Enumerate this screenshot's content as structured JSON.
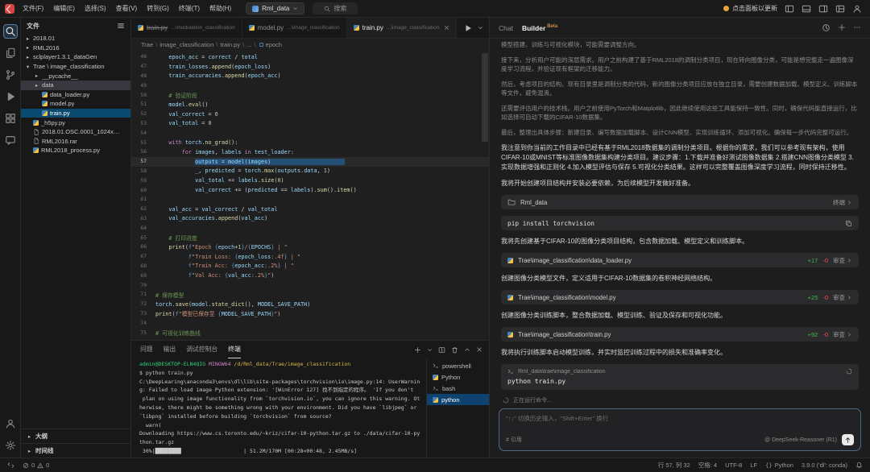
{
  "colors": {
    "selection": "#264f78",
    "list_active": "#0a4a6e",
    "added": "#3fb950",
    "removed": "#f85149",
    "beta": "#c98f4e",
    "update_dot": "#e8a33d"
  },
  "titlebar": {
    "menus": [
      "文件(F)",
      "编辑(E)",
      "选择(S)",
      "查看(V)",
      "转到(G)",
      "终端(T)",
      "帮助(H)"
    ],
    "project": "Rml_data",
    "search": "搜索",
    "update": "点击面板以更新"
  },
  "activity": {
    "top": [
      "search",
      "files",
      "scm",
      "debug",
      "extensions",
      "chat"
    ],
    "bottom": [
      "account",
      "settings"
    ]
  },
  "sidebar": {
    "title": "文件",
    "tree": [
      {
        "label": "2018.01",
        "depth": 0,
        "kind": "folder"
      },
      {
        "label": "RML2016",
        "depth": 0,
        "kind": "folder"
      },
      {
        "label": "sclplayer1.3.1_dataGen",
        "depth": 0,
        "kind": "folder"
      },
      {
        "label": "Trae \\ image_classification",
        "depth": 0,
        "kind": "folder",
        "expanded": true
      },
      {
        "label": "__pycache__",
        "depth": 1,
        "kind": "folder"
      },
      {
        "label": "data",
        "depth": 1,
        "kind": "folder",
        "boxed": true
      },
      {
        "label": "data_loader.py",
        "depth": 1,
        "kind": "py"
      },
      {
        "label": "model.py",
        "depth": 1,
        "kind": "py"
      },
      {
        "label": "train.py",
        "depth": 1,
        "kind": "py",
        "selected": true
      },
      {
        "label": "_h5py.py",
        "depth": 0,
        "kind": "py"
      },
      {
        "label": "2018.01.OSC.0001_1024x…",
        "depth": 0,
        "kind": "file"
      },
      {
        "label": "RML2016.rar",
        "depth": 0,
        "kind": "file"
      },
      {
        "label": "RML2018_process.py",
        "depth": 0,
        "kind": "py"
      }
    ],
    "outline": "大纲",
    "timeline": "时间线"
  },
  "editor": {
    "tabs": [
      {
        "name": "train.py",
        "path": "...\\modulation_classification",
        "deleted": true
      },
      {
        "name": "model.py",
        "path": "...\\image_classification"
      },
      {
        "name": "train.py",
        "path": "...\\image_classification",
        "active": true
      }
    ],
    "breadcrumb": [
      "Trae",
      "image_classification",
      "train.py",
      "...",
      "epoch"
    ],
    "code": {
      "start": 46,
      "current": 57,
      "lines": [
        {
          "i": 4,
          "t": [
            [
              "v",
              "epoch_acc"
            ],
            [
              "o",
              " = "
            ],
            [
              "v",
              "correct"
            ],
            [
              "o",
              " / "
            ],
            [
              "v",
              "total"
            ]
          ]
        },
        {
          "i": 4,
          "t": [
            [
              "v",
              "train_losses"
            ],
            [
              "o",
              "."
            ],
            [
              "f",
              "append"
            ],
            [
              "o",
              "("
            ],
            [
              "v",
              "epoch_loss"
            ],
            [
              "o",
              ")"
            ]
          ]
        },
        {
          "i": 4,
          "t": [
            [
              "v",
              "train_accuracies"
            ],
            [
              "o",
              "."
            ],
            [
              "f",
              "append"
            ],
            [
              "o",
              "("
            ],
            [
              "v",
              "epoch_acc"
            ],
            [
              "o",
              ")"
            ]
          ]
        },
        {
          "i": 0,
          "t": []
        },
        {
          "i": 4,
          "t": [
            [
              "c",
              "# 验证阶段"
            ]
          ]
        },
        {
          "i": 4,
          "t": [
            [
              "v",
              "model"
            ],
            [
              "o",
              "."
            ],
            [
              "f",
              "eval"
            ],
            [
              "o",
              "()"
            ]
          ]
        },
        {
          "i": 4,
          "t": [
            [
              "v",
              "val_correct"
            ],
            [
              "o",
              " = "
            ],
            [
              "n",
              "0"
            ]
          ]
        },
        {
          "i": 4,
          "t": [
            [
              "v",
              "val_total"
            ],
            [
              "o",
              " = "
            ],
            [
              "n",
              "0"
            ]
          ]
        },
        {
          "i": 0,
          "t": []
        },
        {
          "i": 4,
          "t": [
            [
              "k",
              "with"
            ],
            [
              "o",
              " "
            ],
            [
              "v",
              "torch"
            ],
            [
              "o",
              "."
            ],
            [
              "f",
              "no_grad"
            ],
            [
              "o",
              "():"
            ]
          ]
        },
        {
          "i": 8,
          "t": [
            [
              "k",
              "for"
            ],
            [
              "o",
              " "
            ],
            [
              "v",
              "images"
            ],
            [
              "o",
              ", "
            ],
            [
              "v",
              "labels"
            ],
            [
              "o",
              " "
            ],
            [
              "k",
              "in"
            ],
            [
              "o",
              " "
            ],
            [
              "v",
              "test_loader"
            ],
            [
              "o",
              ":"
            ]
          ]
        },
        {
          "i": 12,
          "t": [
            [
              "v",
              "outputs"
            ],
            [
              "o",
              " = "
            ],
            [
              "v",
              "model"
            ],
            [
              "o",
              "("
            ],
            [
              "v",
              "images"
            ],
            [
              "o",
              ")"
            ]
          ]
        },
        {
          "i": 12,
          "t": [
            [
              "v",
              "_"
            ],
            [
              "o",
              ", "
            ],
            [
              "v",
              "predicted"
            ],
            [
              "o",
              " = "
            ],
            [
              "v",
              "torch"
            ],
            [
              "o",
              "."
            ],
            [
              "f",
              "max"
            ],
            [
              "o",
              "("
            ],
            [
              "v",
              "outputs"
            ],
            [
              "o",
              "."
            ],
            [
              "v",
              "data"
            ],
            [
              "o",
              ", "
            ],
            [
              "n",
              "1"
            ],
            [
              "o",
              ")"
            ]
          ]
        },
        {
          "i": 12,
          "t": [
            [
              "v",
              "val_total"
            ],
            [
              "o",
              " += "
            ],
            [
              "v",
              "labels"
            ],
            [
              "o",
              "."
            ],
            [
              "f",
              "size"
            ],
            [
              "o",
              "("
            ],
            [
              "n",
              "0"
            ],
            [
              "o",
              ")"
            ]
          ]
        },
        {
          "i": 12,
          "t": [
            [
              "v",
              "val_correct"
            ],
            [
              "o",
              " += ("
            ],
            [
              "v",
              "predicted"
            ],
            [
              "o",
              " == "
            ],
            [
              "v",
              "labels"
            ],
            [
              "o",
              ")."
            ],
            [
              "f",
              "sum"
            ],
            [
              "o",
              "()."
            ],
            [
              "f",
              "item"
            ],
            [
              "o",
              "()"
            ]
          ]
        },
        {
          "i": 0,
          "t": []
        },
        {
          "i": 4,
          "t": [
            [
              "v",
              "val_acc"
            ],
            [
              "o",
              " = "
            ],
            [
              "v",
              "val_correct"
            ],
            [
              "o",
              " / "
            ],
            [
              "v",
              "val_total"
            ]
          ]
        },
        {
          "i": 4,
          "t": [
            [
              "v",
              "val_accuracies"
            ],
            [
              "o",
              "."
            ],
            [
              "f",
              "append"
            ],
            [
              "o",
              "("
            ],
            [
              "v",
              "val_acc"
            ],
            [
              "o",
              ")"
            ]
          ]
        },
        {
          "i": 0,
          "t": []
        },
        {
          "i": 4,
          "t": [
            [
              "c",
              "# 打印进度"
            ]
          ]
        },
        {
          "i": 4,
          "t": [
            [
              "f",
              "print"
            ],
            [
              "o",
              "("
            ],
            [
              "b",
              "f"
            ],
            [
              "s",
              "\"Epoch "
            ],
            [
              "b",
              "{"
            ],
            [
              "v",
              "epoch"
            ],
            [
              "o",
              "+"
            ],
            [
              "n",
              "1"
            ],
            [
              "b",
              "}"
            ],
            [
              "s",
              "/"
            ],
            [
              "b",
              "{"
            ],
            [
              "v",
              "EPOCHS"
            ],
            [
              "b",
              "}"
            ],
            [
              "s",
              " | \""
            ]
          ]
        },
        {
          "i": 10,
          "t": [
            [
              "b",
              "f"
            ],
            [
              "s",
              "\"Train Loss: "
            ],
            [
              "b",
              "{"
            ],
            [
              "v",
              "epoch_loss"
            ],
            [
              "s",
              ":.4f"
            ],
            [
              "b",
              "}"
            ],
            [
              "s",
              " | \""
            ]
          ]
        },
        {
          "i": 10,
          "t": [
            [
              "b",
              "f"
            ],
            [
              "s",
              "\"Train Acc: "
            ],
            [
              "b",
              "{"
            ],
            [
              "v",
              "epoch_acc"
            ],
            [
              "s",
              ":.2%"
            ],
            [
              "b",
              "}"
            ],
            [
              "s",
              " | \""
            ]
          ]
        },
        {
          "i": 10,
          "t": [
            [
              "b",
              "f"
            ],
            [
              "s",
              "\"Val Acc: "
            ],
            [
              "b",
              "{"
            ],
            [
              "v",
              "val_acc"
            ],
            [
              "s",
              ":.2%"
            ],
            [
              "b",
              "}"
            ],
            [
              "s",
              "\""
            ],
            [
              "o",
              ")"
            ]
          ]
        },
        {
          "i": 0,
          "t": []
        },
        {
          "i": 0,
          "t": [
            [
              "c",
              "# 保存模型"
            ]
          ]
        },
        {
          "i": 0,
          "t": [
            [
              "v",
              "torch"
            ],
            [
              "o",
              "."
            ],
            [
              "f",
              "save"
            ],
            [
              "o",
              "("
            ],
            [
              "v",
              "model"
            ],
            [
              "o",
              "."
            ],
            [
              "f",
              "state_dict"
            ],
            [
              "o",
              "(), "
            ],
            [
              "v",
              "MODEL_SAVE_PATH"
            ],
            [
              "o",
              ")"
            ]
          ]
        },
        {
          "i": 0,
          "t": [
            [
              "f",
              "print"
            ],
            [
              "o",
              "("
            ],
            [
              "b",
              "f"
            ],
            [
              "s",
              "\"模型已保存至 "
            ],
            [
              "b",
              "{"
            ],
            [
              "v",
              "MODEL_SAVE_PATH"
            ],
            [
              "b",
              "}"
            ],
            [
              "s",
              "\""
            ],
            [
              "o",
              ")"
            ]
          ]
        },
        {
          "i": 0,
          "t": []
        },
        {
          "i": 0,
          "t": [
            [
              "c",
              "# 可视化训练曲线"
            ]
          ]
        }
      ]
    }
  },
  "panel": {
    "tabs": [
      {
        "label": "问题"
      },
      {
        "label": "输出"
      },
      {
        "label": "调试控制台"
      },
      {
        "label": "终端",
        "active": true
      }
    ],
    "terminals": [
      {
        "name": "powershell",
        "icon": "terminal"
      },
      {
        "name": "Python",
        "icon": "python"
      },
      {
        "name": "bash",
        "icon": "terminal"
      },
      {
        "name": "python",
        "icon": "python",
        "active": true
      }
    ],
    "output": [
      [
        [
          "tg",
          "admin@DESKTOP-ELN4QIG "
        ],
        [
          "tp",
          "MINGW64 "
        ],
        [
          "ty",
          "/d/Rml_data/Trae/image_classification"
        ]
      ],
      [
        [
          "tw",
          "$ python train.py"
        ]
      ],
      [
        [
          "tw",
          "C:\\DeepLearing\\anaconda3\\envs\\dl\\lib\\site-packages\\torchvision\\io\\image.py:14: UserWarnin"
        ]
      ],
      [
        [
          "tw",
          "g: Failed to load image Python extension: '[WinError 127] 找不到指定的程序。 'If you don't"
        ]
      ],
      [
        [
          "tw",
          " plan on using image functionality from `torchvision.io`, you can ignore this warning. Ot"
        ]
      ],
      [
        [
          "tw",
          "herwise, there might be something wrong with your environment. Did you have `libjpeg` or "
        ]
      ],
      [
        [
          "tw",
          "`libpng` installed before building `torchvision` from source?"
        ]
      ],
      [
        [
          "tw",
          "  warn("
        ]
      ],
      [
        [
          "tw",
          "Downloading https://www.cs.toronto.edu/~kriz/cifar-10-python.tar.gz to ./data/cifar-10-py"
        ]
      ],
      [
        [
          "tw",
          "thon.tar.gz"
        ]
      ],
      [
        [
          "tw",
          " 30%|████████▎                   | 51.2M/170M [00:28<00:48, 2.45MB/s]"
        ]
      ]
    ]
  },
  "chat": {
    "tab_chat": "Chat",
    "tab_builder": "Builder",
    "beta": "Beta",
    "blocks": [
      {
        "type": "think",
        "text": "模型搭建、训练与可视化模块，可能需要调整方向。"
      },
      {
        "type": "think",
        "text": "接下来，分析用户可能的深层需求。用户之前构建了基于RML2018的调制分类项目，现在转向图像分类，可能是想完整走一遍图像深度学习流程，并验证现有框架的迁移能力。"
      },
      {
        "type": "think",
        "text": "然后，考虑项目的结构。现有目录里是调制分类的代码，新的图像分类项目应放在独立目录，需要创建数据加载、模型定义、训练脚本等文件，避免混淆。"
      },
      {
        "type": "think",
        "text": "还需要评估用户的技术栈。用户之前使用PyTorch和Matplotlib，因此继续使用这些工具能保持一致性。同时，确保代码能直接运行，比如选择可自动下载的CIFAR-10数据集。"
      },
      {
        "type": "think",
        "text": "最后，整理出具体步骤：新建目录、编写数据加载脚本、设计CNN模型、实现训练循环、添加可视化。确保每一步代码完整可运行。"
      },
      {
        "type": "p",
        "text": "我注意到你当前的工作目录中已经有基于RML2018数据集的调制分类项目。根据你的需求，我们可以参考现有架构，使用CIFAR-10或MNIST等标准图像数据集构建分类项目。建议步骤：1.下载并准备好测试图像数据集 2.搭建CNN图像分类模型 3.实现数据增强和正则化 4.加入模型评估与保存 5.可视化分类结果。这样可以完整覆盖图像深度学习流程，同时保持迁移性。"
      },
      {
        "type": "p",
        "text": "我将开始创建项目结构并安装必要依赖，为后续模型开发做好准备。"
      },
      {
        "type": "wscard",
        "title": "Rml_data",
        "action": "终端"
      },
      {
        "type": "cmd",
        "text": "pip install torchvision"
      },
      {
        "type": "p",
        "text": "我将先创建基于CIFAR-10的图像分类项目结构，包含数据加载、模型定义和训练脚本。"
      },
      {
        "type": "filecard",
        "path": "Trae\\image_classification\\data_loader.py",
        "added": "+17",
        "removed": "-0",
        "action": "审查"
      },
      {
        "type": "p",
        "text": "创建图像分类模型文件，定义适用于CIFAR-10数据集的卷积神经网络结构。"
      },
      {
        "type": "filecard",
        "path": "Trae\\image_classification\\model.py",
        "added": "+25",
        "removed": "-0",
        "action": "审查"
      },
      {
        "type": "p",
        "text": "创建图像分类训练脚本，整合数据加载、模型训练、验证及保存和可视化功能。"
      },
      {
        "type": "filecard",
        "path": "Trae\\image_classification\\train.py",
        "added": "+92",
        "removed": "-0",
        "action": "审查"
      },
      {
        "type": "p",
        "text": "我将执行训练脚本启动模型训练，并实时监控训练过程中的损失和准确率变化。"
      },
      {
        "type": "termcard",
        "path": "Rml_data\\trae\\image_classification",
        "cmd": "python train.py"
      }
    ],
    "hint": "正在运行命令...",
    "input": {
      "placeholder": "\"↑↓\" 切换历史输入，\"Shift+Enter\" 换行",
      "reference": "# 引用",
      "model": "@ DeepSeek-Reasoner (R1)"
    }
  },
  "statusbar": {
    "errors": "0",
    "warnings": "0",
    "cursor": "行 57, 列 32",
    "indent": "空格: 4",
    "encoding": "UTF-8",
    "eol": "LF",
    "language": "Python",
    "interpreter": "3.9.0 ('dl': conda)"
  }
}
